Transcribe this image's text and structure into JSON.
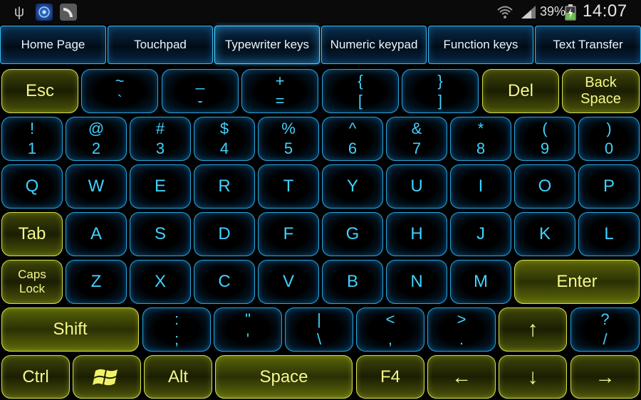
{
  "status_bar": {
    "left_icons": [
      "usb-icon",
      "app-icon",
      "app-icon-2"
    ],
    "battery_percent": "39%",
    "time": "14:07"
  },
  "tabs": [
    {
      "label": "Home Page"
    },
    {
      "label": "Touchpad"
    },
    {
      "label": "Typewriter keys",
      "active": true
    },
    {
      "label": "Numeric keypad"
    },
    {
      "label": "Function keys"
    },
    {
      "label": "Text Transfer"
    }
  ],
  "keyboard": {
    "row1": {
      "esc": "Esc",
      "k1_top": "~",
      "k1_bottom": "`",
      "k2_top": "_",
      "k2_bottom": "-",
      "k3_top": "+",
      "k3_bottom": "=",
      "k4_top": "{",
      "k4_bottom": "[",
      "k5_top": "}",
      "k5_bottom": "]",
      "del": "Del",
      "backspace_1": "Back",
      "backspace_2": "Space"
    },
    "row2": [
      {
        "top": "!",
        "bottom": "1"
      },
      {
        "top": "@",
        "bottom": "2"
      },
      {
        "top": "#",
        "bottom": "3"
      },
      {
        "top": "$",
        "bottom": "4"
      },
      {
        "top": "%",
        "bottom": "5"
      },
      {
        "top": "^",
        "bottom": "6"
      },
      {
        "top": "&",
        "bottom": "7"
      },
      {
        "top": "*",
        "bottom": "8"
      },
      {
        "top": "(",
        "bottom": "9"
      },
      {
        "top": ")",
        "bottom": "0"
      }
    ],
    "row3": [
      "Q",
      "W",
      "E",
      "R",
      "T",
      "Y",
      "U",
      "I",
      "O",
      "P"
    ],
    "row4": {
      "tab": "Tab",
      "keys": [
        "A",
        "S",
        "D",
        "F",
        "G",
        "H",
        "J",
        "K",
        "L"
      ]
    },
    "row5": {
      "caps_1": "Caps",
      "caps_2": "Lock",
      "keys": [
        "Z",
        "X",
        "C",
        "V",
        "B",
        "N",
        "M"
      ],
      "enter": "Enter"
    },
    "row6": {
      "shift": "Shift",
      "keys": [
        {
          "top": ":",
          "bottom": ";"
        },
        {
          "top": "\"",
          "bottom": "'"
        },
        {
          "top": "|",
          "bottom": "\\"
        },
        {
          "top": "<",
          "bottom": ","
        },
        {
          "top": ">",
          "bottom": "."
        }
      ],
      "up": "↑",
      "last": {
        "top": "?",
        "bottom": "/"
      }
    },
    "row7": {
      "ctrl": "Ctrl",
      "win_icon": "windows-logo-icon",
      "alt": "Alt",
      "space": "Space",
      "f4": "F4",
      "left": "←",
      "down": "↓",
      "right": "→"
    }
  },
  "colors": {
    "blue_accent": "#2aa3dd",
    "yellow_accent": "#d6e04a",
    "background": "#000000"
  }
}
